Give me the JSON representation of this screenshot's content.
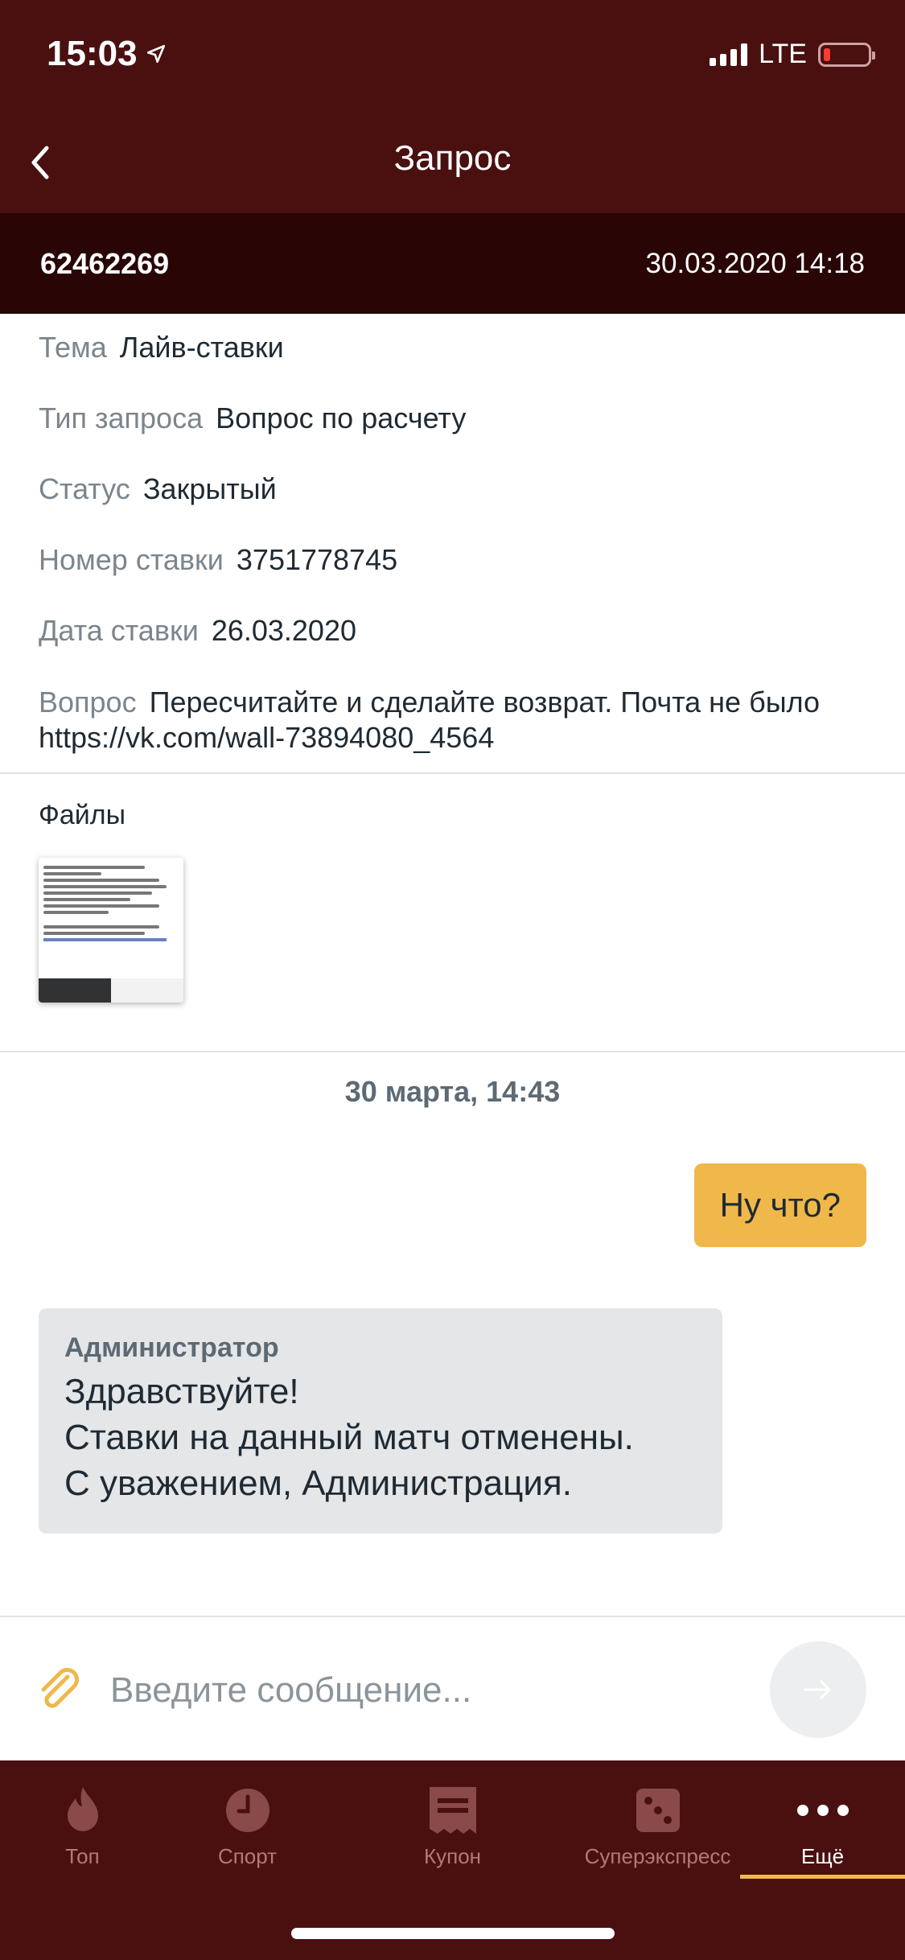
{
  "status_bar": {
    "time": "15:03",
    "network": "LTE"
  },
  "header": {
    "title": "Запрос"
  },
  "request": {
    "id": "62462269",
    "datetime": "30.03.2020 14:18"
  },
  "info": [
    {
      "key": "Тема",
      "value": "Лайв-ставки"
    },
    {
      "key": "Тип запроса",
      "value": "Вопрос по расчету"
    },
    {
      "key": "Статус",
      "value": "Закрытый"
    },
    {
      "key": "Номер ставки",
      "value": "3751778745"
    },
    {
      "key": "Дата ставки",
      "value": "26.03.2020"
    },
    {
      "key": "Вопрос",
      "value": "Пересчитайте и сделайте возврат. Почта не было https://vk.com/wall-73894080_4564"
    }
  ],
  "files": {
    "title": "Файлы"
  },
  "chat": {
    "date_separator": "30 марта, 14:43",
    "outgoing": {
      "text": "Ну что?"
    },
    "incoming": {
      "author": "Администратор",
      "text": "Здравствуйте!\nСтавки на данный матч отменены.\nС уважением, Администрация."
    }
  },
  "composer": {
    "placeholder": "Введите сообщение..."
  },
  "tabs": [
    {
      "label": "Топ",
      "icon": "fire-icon"
    },
    {
      "label": "Спорт",
      "icon": "clock-icon"
    },
    {
      "label": "Купон",
      "icon": "coupon-icon"
    },
    {
      "label": "Суперэкспресс",
      "icon": "dice-icon"
    },
    {
      "label": "Ещё",
      "icon": "more-icon",
      "active": true
    }
  ],
  "colors": {
    "header_bg": "#4a1010",
    "request_bar_bg": "#290505",
    "accent": "#f0b84a",
    "incoming_bubble": "#e4e6e8"
  }
}
